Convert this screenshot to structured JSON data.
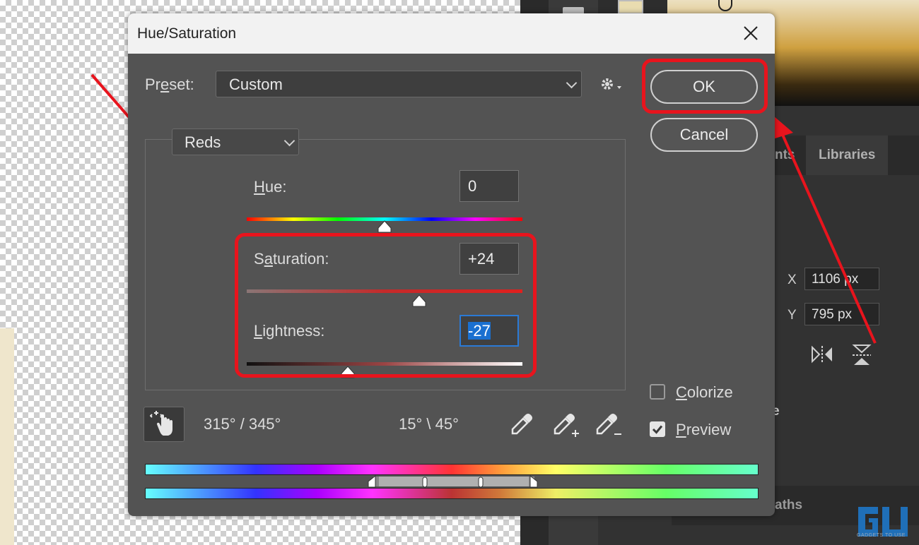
{
  "dialog": {
    "title": "Hue/Saturation",
    "preset_label_pre": "Pr",
    "preset_label_u": "e",
    "preset_label_post": "set:",
    "preset_value": "Custom",
    "channel_value": "Reds",
    "ok_label": "OK",
    "cancel_label": "Cancel",
    "hue": {
      "label_u": "H",
      "label_rest": "ue:",
      "value": "0"
    },
    "saturation": {
      "label_pre": "S",
      "label_u": "a",
      "label_rest": "turation:",
      "value": "+24"
    },
    "lightness": {
      "label_u": "L",
      "label_rest": "ightness:",
      "value": "-27"
    },
    "colorize": {
      "label_u": "C",
      "label_rest": "olorize",
      "checked": false
    },
    "preview": {
      "label_u": "P",
      "label_rest": "review",
      "checked": true
    },
    "range_left": "315° / 345°",
    "range_right": "15° \\ 45°"
  },
  "background": {
    "tab_libraries": "Libraries",
    "tab_partial": "nts",
    "x_label": "X",
    "x_value": "1106 px",
    "y_label": "Y",
    "y_value": "795 px",
    "partial_e": "e",
    "paths_partial": "aths",
    "watermark": "GADGETS TO USE"
  },
  "colors": {
    "highlight": "#e8141d",
    "focus_blue": "#1a70d0"
  }
}
